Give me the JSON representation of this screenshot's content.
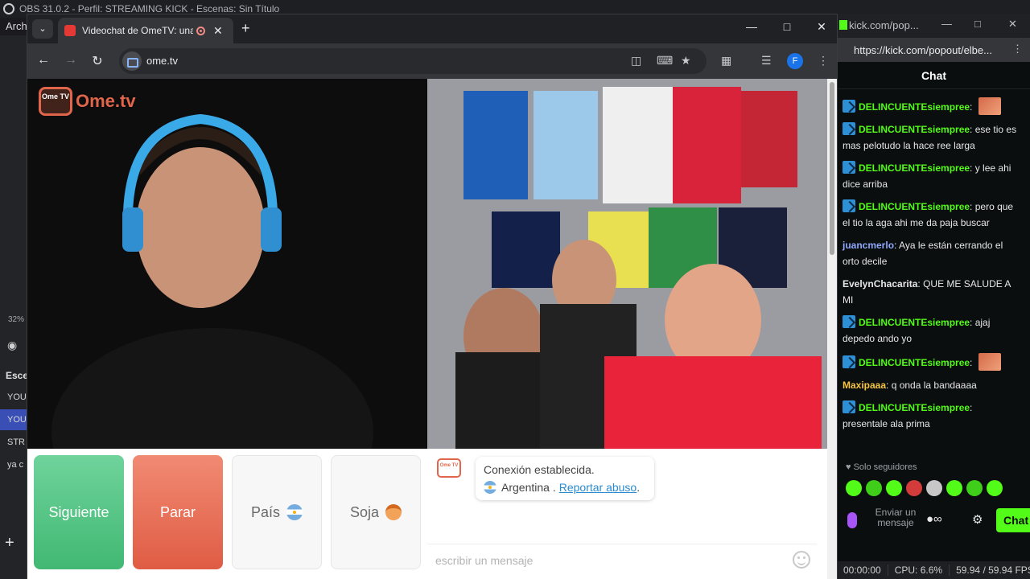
{
  "obs": {
    "title": "OBS 31.0.2 - Perfil: STREAMING KICK - Escenas: Sin Título",
    "menu": "Arch",
    "zoom": "32%",
    "scenes_header": "Esce",
    "scenes": [
      "YOU",
      "YOU",
      "STR",
      "ya c"
    ],
    "status": {
      "time": "00:00:00",
      "cpu": "CPU: 6.6%",
      "fps": "59.94 / 59.94 FPS"
    }
  },
  "browser": {
    "tab_title": "Videochat de OmeTV: una a",
    "url": "ome.tv",
    "profile_initial": "F"
  },
  "ometv": {
    "logo_badge": "Ome TV",
    "logo_text": "Ome.tv",
    "buttons": {
      "next": "Siguiente",
      "stop": "Parar",
      "country": "País",
      "gender": "Soja"
    },
    "notice": {
      "logo": "Ome TV",
      "status": "Conexión establecida.",
      "country": "Argentina .",
      "report": "Reportar abuso",
      "trailing": "."
    },
    "input_placeholder": "escribir un mensaje"
  },
  "kick": {
    "tab_title": "kick.com/pop...",
    "url": "https://kick.com/popout/elbe...",
    "chat_title": "Chat",
    "messages": [
      {
        "user": "DELINCUENTEsiempree",
        "color": "#53fc18",
        "text": "",
        "badge": true,
        "emote": true
      },
      {
        "user": "DELINCUENTEsiempree",
        "color": "#53fc18",
        "text": "ese tio es mas pelotudo la hace ree larga",
        "badge": true,
        "emote": false
      },
      {
        "user": "DELINCUENTEsiempree",
        "color": "#53fc18",
        "text": "y lee ahi dice arriba",
        "badge": true,
        "emote": false
      },
      {
        "user": "DELINCUENTEsiempree",
        "color": "#53fc18",
        "text": "pero que el tio la aga ahi me da paja buscar",
        "badge": true,
        "emote": false
      },
      {
        "user": "juancmerlo",
        "color": "#8fa8ff",
        "text": "Aya le están cerrando el orto decile",
        "badge": false,
        "emote": false
      },
      {
        "user": "EvelynChacarita",
        "color": "#e6e6e6",
        "text": "QUE ME SALUDE A MI",
        "badge": false,
        "emote": false
      },
      {
        "user": "DELINCUENTEsiempree",
        "color": "#53fc18",
        "text": "ajaj depedo ando yo",
        "badge": true,
        "emote": false
      },
      {
        "user": "DELINCUENTEsiempree",
        "color": "#53fc18",
        "text": "",
        "badge": true,
        "emote": true
      },
      {
        "user": "Maxipaaa",
        "color": "#f5c542",
        "text": "q onda la bandaaaa",
        "badge": false,
        "emote": false
      },
      {
        "user": "DELINCUENTEsiempree",
        "color": "#53fc18",
        "text": "presentale ala prima",
        "badge": true,
        "emote": false
      }
    ],
    "followers_only": "Solo seguidores",
    "input_placeholder": "Enviar un mensaje",
    "chat_button": "Chat"
  },
  "colors": {
    "kick_green": "#53fc18",
    "ometv_green": "#41b873",
    "ometv_red": "#e05c44",
    "ometv_orange": "#e0664b"
  }
}
